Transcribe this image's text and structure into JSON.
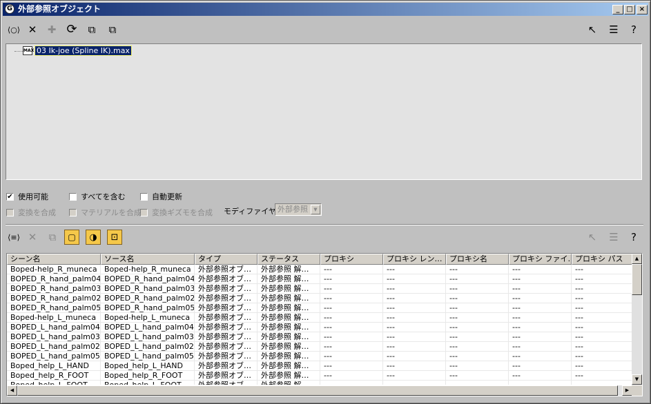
{
  "window": {
    "title": "外部参照オブジェクト",
    "app_icon_glyph": "G",
    "minimize_glyph": "_",
    "maximize_glyph": "□",
    "close_glyph": "×"
  },
  "top_toolbar": {
    "icons": {
      "config": "⟨○⟩",
      "remove": "✕",
      "add": "✚",
      "refresh": "⟳",
      "merge": "⧉",
      "convert": "⧉"
    },
    "right_icons": {
      "select": "↖",
      "select_by_list": "☰",
      "help": "?"
    }
  },
  "tree": {
    "file_icon_text": "MAX",
    "file_name": "03 Ik-joe (Spline IK).max"
  },
  "options": {
    "enabled": {
      "label": "使用可能",
      "checked": true
    },
    "include_all": {
      "label": "すべてを含む",
      "checked": false
    },
    "auto_update": {
      "label": "自動更新",
      "checked": false
    },
    "merge_transforms": {
      "label": "変換を合成",
      "checked": false
    },
    "merge_materials": {
      "label": "マテリアルを合成",
      "checked": false
    },
    "merge_manipulators": {
      "label": "変換ギズモを合成",
      "checked": false
    },
    "modifier_label": "モディファイヤ :",
    "modifier_value": "外部参照"
  },
  "bottom_toolbar": {
    "icons": {
      "list_config": "⟨≡⟩",
      "remove": "✕",
      "merge": "⧉",
      "objects_filter": "▢",
      "materials_filter": "◑",
      "controllers_filter": "⊡"
    }
  },
  "table": {
    "columns": [
      "シーン名",
      "ソース名",
      "タイプ",
      "ステータス",
      "プロキシ",
      "プロキシ レン…",
      "プロキシ名",
      "プロキシ ファイ…",
      "プロキシ パス"
    ],
    "rows": [
      [
        "Boped-help_R_muneca",
        "Boped-help_R_muneca",
        "外部参照オブ…",
        "外部参照 解…",
        "---",
        "---",
        "---",
        "---",
        "---"
      ],
      [
        "BOPED_R_hand_palm04",
        "BOPED_R_hand_palm04",
        "外部参照オブ…",
        "外部参照 解…",
        "---",
        "---",
        "---",
        "---",
        "---"
      ],
      [
        "BOPED_R_hand_palm03",
        "BOPED_R_hand_palm03",
        "外部参照オブ…",
        "外部参照 解…",
        "---",
        "---",
        "---",
        "---",
        "---"
      ],
      [
        "BOPED_R_hand_palm02",
        "BOPED_R_hand_palm02",
        "外部参照オブ…",
        "外部参照 解…",
        "---",
        "---",
        "---",
        "---",
        "---"
      ],
      [
        "BOPED_R_hand_palm05",
        "BOPED_R_hand_palm05",
        "外部参照オブ…",
        "外部参照 解…",
        "---",
        "---",
        "---",
        "---",
        "---"
      ],
      [
        "Boped-help_L_muneca",
        "Boped-help_L_muneca",
        "外部参照オブ…",
        "外部参照 解…",
        "---",
        "---",
        "---",
        "---",
        "---"
      ],
      [
        "BOPED_L_hand_palm04",
        "BOPED_L_hand_palm04",
        "外部参照オブ…",
        "外部参照 解…",
        "---",
        "---",
        "---",
        "---",
        "---"
      ],
      [
        "BOPED_L_hand_palm03",
        "BOPED_L_hand_palm03",
        "外部参照オブ…",
        "外部参照 解…",
        "---",
        "---",
        "---",
        "---",
        "---"
      ],
      [
        "BOPED_L_hand_palm02",
        "BOPED_L_hand_palm02",
        "外部参照オブ…",
        "外部参照 解…",
        "---",
        "---",
        "---",
        "---",
        "---"
      ],
      [
        "BOPED_L_hand_palm05",
        "BOPED_L_hand_palm05",
        "外部参照オブ…",
        "外部参照 解…",
        "---",
        "---",
        "---",
        "---",
        "---"
      ],
      [
        "Boped_help_L_HAND",
        "Boped_help_L_HAND",
        "外部参照オブ…",
        "外部参照 解…",
        "---",
        "---",
        "---",
        "---",
        "---"
      ],
      [
        "Boped_help_R_FOOT",
        "Boped_help_R_FOOT",
        "外部参照オブ…",
        "外部参照 解…",
        "---",
        "---",
        "---",
        "---",
        "---"
      ],
      [
        "Boped_help_L_FOOT",
        "Boped_help_L_FOOT",
        "外部参照オブ…",
        "外部参照 解…",
        "---",
        "---",
        "---",
        "---",
        "---"
      ]
    ],
    "scroll_up": "▲",
    "scroll_down": "▼",
    "scroll_left": "◀",
    "scroll_right": "▶"
  }
}
